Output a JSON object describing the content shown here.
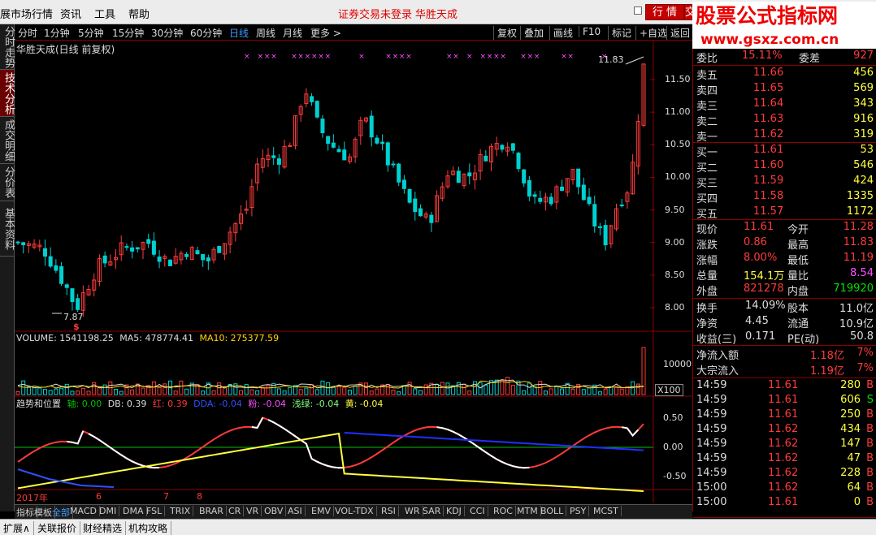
{
  "menu": {
    "items": [
      "展市场行情",
      "资讯",
      "工具",
      "帮助"
    ],
    "login_status": "证券交易未登录",
    "stock_title": "华胜天成",
    "quote_button": "行 情",
    "trade_button": "交"
  },
  "watermark": {
    "title": "股票公式指标网",
    "url": "www.gsxz.com.cn"
  },
  "sidebar": {
    "tabs": [
      "分时走势",
      "技术分析",
      "成交明细",
      "分价表",
      "基本资料"
    ],
    "active_index": 1
  },
  "periods": {
    "items": [
      "分时",
      "1分钟",
      "5分钟",
      "15分钟",
      "30分钟",
      "60分钟",
      "日线",
      "周线",
      "月线",
      "更多 >"
    ],
    "active": "日线"
  },
  "toolbar": {
    "items": [
      "复权",
      "叠加",
      "画线",
      "F10",
      "标记",
      "+自选",
      "返回"
    ]
  },
  "chart": {
    "header": "华胜天成(日线 前复权)",
    "high_label": "11.83",
    "low_label": "7.87",
    "price_ticks": [
      "11.50",
      "11.00",
      "10.50",
      "10.00",
      "9.50",
      "9.00",
      "8.50",
      "8.00"
    ],
    "price_tick_values": [
      11.5,
      11.0,
      10.5,
      10.0,
      9.5,
      9.0,
      8.5,
      8.0
    ],
    "volume_header": {
      "volume": "VOLUME: 1541198.25",
      "ma5": "MA5: 478774.41",
      "ma10": "MA10: 275377.59"
    },
    "volume_tick": "10000",
    "volume_unit": "X100",
    "indicator_header": {
      "name": "趋势和位置",
      "axis": "轴: 0.00",
      "db": "DB: 0.39",
      "red": "红: 0.39",
      "dda": "DDA: -0.04",
      "pink": "粉: -0.04",
      "lightgreen": "浅绿: -0.04",
      "yellow": "黄: -0.04"
    },
    "indicator_ticks": [
      "0.50",
      "0.00",
      "-0.50"
    ],
    "time_labels": [
      "2017年",
      "6",
      "7",
      "8"
    ],
    "colors": {
      "up": "#ff3b3b",
      "down": "#00d0d0",
      "grid": "#8b0000"
    }
  },
  "indicator_tabs": [
    "指标",
    "模板",
    "全部",
    "MACD",
    "DMI",
    "DMA",
    "FSL",
    "TRIX",
    "BRAR",
    "CR",
    "VR",
    "OBV",
    "ASI",
    "EMV",
    "VOL-TDX",
    "RSI",
    "WR",
    "SAR",
    "KDJ",
    "CCI",
    "ROC",
    "MTM",
    "BOLL",
    "PSY",
    "MCST"
  ],
  "quote": {
    "webi": {
      "label": "委比",
      "value": "15.11%",
      "label2": "委差",
      "value2": "927"
    },
    "asks": [
      {
        "label": "卖五",
        "price": "11.66",
        "vol": "456"
      },
      {
        "label": "卖四",
        "price": "11.65",
        "vol": "569"
      },
      {
        "label": "卖三",
        "price": "11.64",
        "vol": "343"
      },
      {
        "label": "卖二",
        "price": "11.63",
        "vol": "916"
      },
      {
        "label": "卖一",
        "price": "11.62",
        "vol": "319"
      }
    ],
    "bids": [
      {
        "label": "买一",
        "price": "11.61",
        "vol": "53"
      },
      {
        "label": "买二",
        "price": "11.60",
        "vol": "546"
      },
      {
        "label": "买三",
        "price": "11.59",
        "vol": "424"
      },
      {
        "label": "买四",
        "price": "11.58",
        "vol": "1335"
      },
      {
        "label": "买五",
        "price": "11.57",
        "vol": "1172"
      }
    ],
    "stats": [
      {
        "l1": "现价",
        "v1": "11.61",
        "l2": "今开",
        "v2": "11.28"
      },
      {
        "l1": "涨跌",
        "v1": "0.86",
        "l2": "最高",
        "v2": "11.83"
      },
      {
        "l1": "涨幅",
        "v1": "8.00%",
        "l2": "最低",
        "v2": "11.19"
      },
      {
        "l1": "总量",
        "v1": "154.1万",
        "l2": "量比",
        "v2": "8.54"
      },
      {
        "l1": "外盘",
        "v1": "821278",
        "l2": "内盘",
        "v2": "719920"
      }
    ],
    "stats2": [
      {
        "l1": "换手",
        "v1": "14.09%",
        "l2": "股本",
        "v2": "11.0亿"
      },
      {
        "l1": "净资",
        "v1": "4.45",
        "l2": "流通",
        "v2": "10.9亿"
      },
      {
        "l1": "收益(三)",
        "v1": "0.171",
        "l2": "PE(动)",
        "v2": "50.8"
      }
    ],
    "flows": [
      {
        "label": "净流入额",
        "value": "1.18亿",
        "pct": "7%"
      },
      {
        "label": "大宗流入",
        "value": "1.19亿",
        "pct": "7%"
      }
    ],
    "ticks": [
      {
        "time": "14:59",
        "price": "11.61",
        "vol": "280",
        "side": "B"
      },
      {
        "time": "14:59",
        "price": "11.61",
        "vol": "606",
        "side": "S"
      },
      {
        "time": "14:59",
        "price": "11.61",
        "vol": "250",
        "side": "B"
      },
      {
        "time": "14:59",
        "price": "11.62",
        "vol": "434",
        "side": "B"
      },
      {
        "time": "14:59",
        "price": "11.62",
        "vol": "147",
        "side": "B"
      },
      {
        "time": "14:59",
        "price": "11.62",
        "vol": "47",
        "side": "B"
      },
      {
        "time": "14:59",
        "price": "11.62",
        "vol": "228",
        "side": "B"
      },
      {
        "time": "15:00",
        "price": "11.62",
        "vol": "64",
        "side": "B"
      },
      {
        "time": "15:00",
        "price": "11.61",
        "vol": "0",
        "side": "B"
      }
    ],
    "bottom_tabs": [
      "笔",
      "价",
      "细",
      "势",
      "联",
      "值",
      "主",
      "筹"
    ]
  },
  "status": {
    "items": [
      "扩展∧",
      "关联报价",
      "财经精选",
      "机构攻略"
    ]
  }
}
